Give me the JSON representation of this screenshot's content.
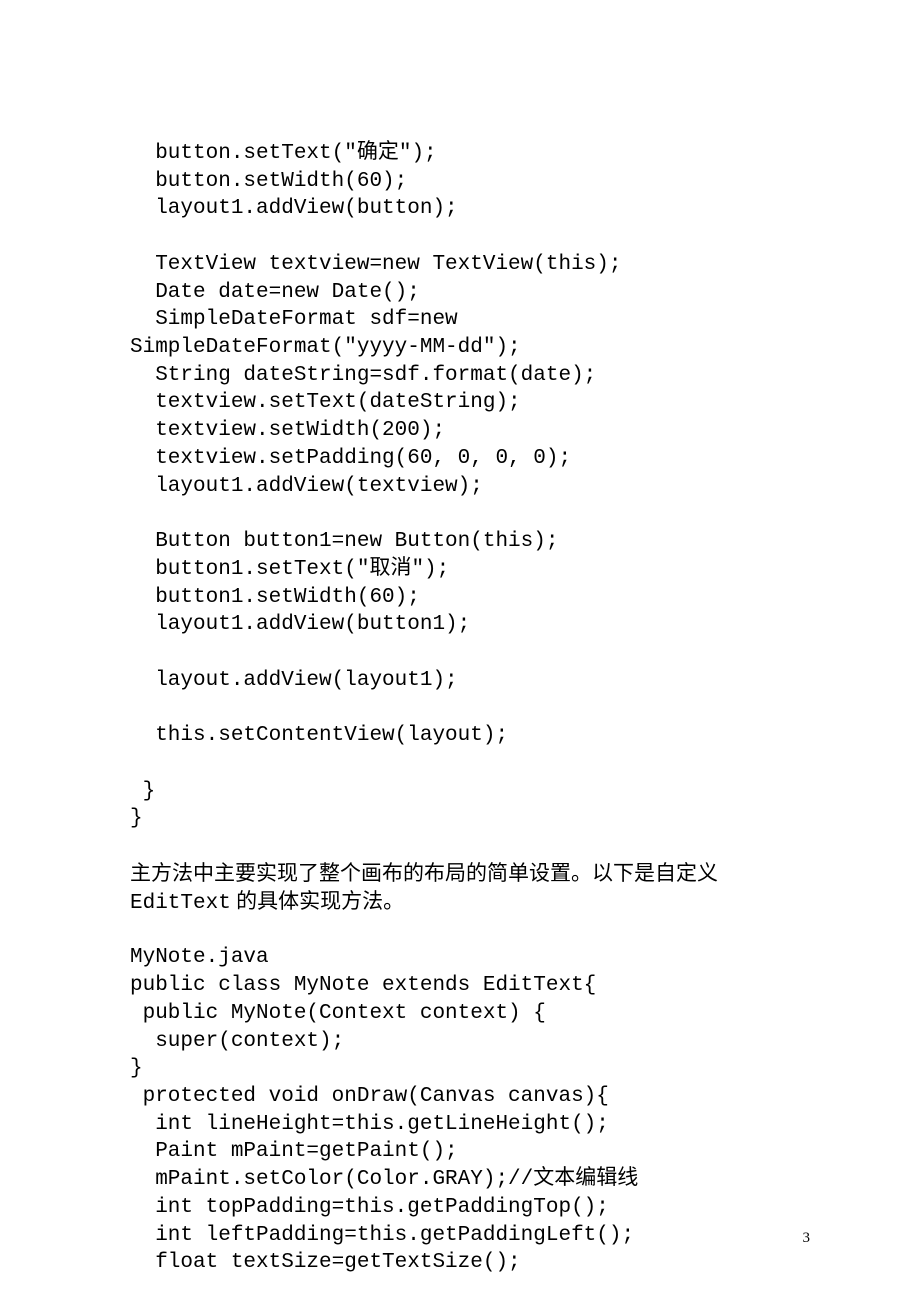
{
  "codeBlock1": "  button.setText(\"确定\");\n  button.setWidth(60);\n  layout1.addView(button);\n\n  TextView textview=new TextView(this);\n  Date date=new Date();\n  SimpleDateFormat sdf=new\nSimpleDateFormat(\"yyyy-MM-dd\");\n  String dateString=sdf.format(date);\n  textview.setText(dateString);\n  textview.setWidth(200);\n  textview.setPadding(60, 0, 0, 0);\n  layout1.addView(textview);\n\n  Button button1=new Button(this);\n  button1.setText(\"取消\");\n  button1.setWidth(60);\n  layout1.addView(button1);\n\n  layout.addView(layout1);\n\n  this.setContentView(layout);\n\n }\n}",
  "prose1_prefix": "主方法中主要实现了整个画布的布局的简单设置。以下是自定义",
  "prose1_line2a": "EditText",
  "prose1_line2b": " 的具体实现方法。",
  "codeBlock2": "MyNote.java\npublic class MyNote extends EditText{\n public MyNote(Context context) {\n  super(context);\n}\n protected void onDraw(Canvas canvas){\n  int lineHeight=this.getLineHeight();\n  Paint mPaint=getPaint();\n  mPaint.setColor(Color.GRAY);//文本编辑线\n  int topPadding=this.getPaddingTop();\n  int leftPadding=this.getPaddingLeft();\n  float textSize=getTextSize();",
  "pageNumber": "3"
}
